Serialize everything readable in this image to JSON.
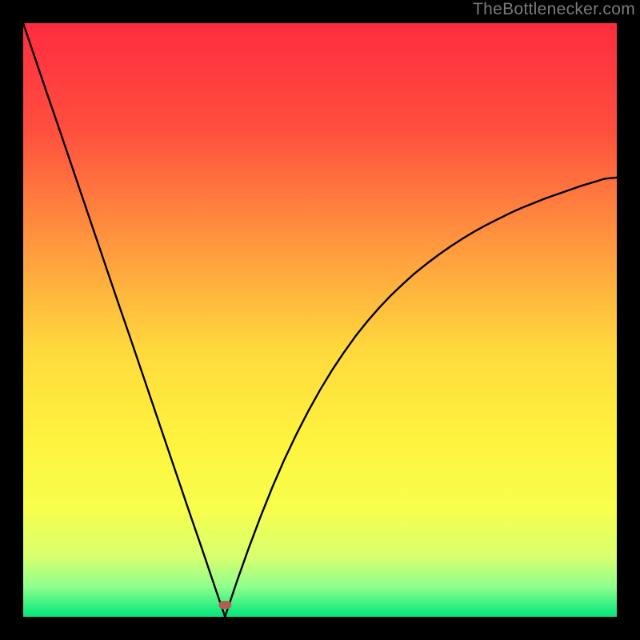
{
  "watermark": "TheBottlenecker.com",
  "chart_data": {
    "type": "line",
    "title": "",
    "xlabel": "",
    "ylabel": "",
    "xlim": [
      0,
      100
    ],
    "ylim": [
      0,
      100
    ],
    "minimum_x": 34,
    "minimum_y": 2,
    "marker": {
      "x": 34,
      "y": 2,
      "color": "#b45b54"
    },
    "x": [
      0,
      2,
      4,
      6,
      8,
      10,
      12,
      14,
      16,
      18,
      20,
      22,
      24,
      26,
      28,
      30,
      32,
      34,
      36,
      38,
      40,
      42,
      44,
      46,
      48,
      50,
      52,
      54,
      56,
      58,
      60,
      62,
      64,
      66,
      68,
      70,
      72,
      74,
      76,
      78,
      80,
      82,
      84,
      86,
      88,
      90,
      92,
      94,
      96,
      98,
      100
    ],
    "values": [
      100.0,
      94.1,
      88.2,
      82.4,
      76.5,
      70.6,
      64.7,
      58.8,
      52.9,
      47.1,
      41.2,
      35.3,
      29.4,
      23.5,
      17.6,
      11.8,
      5.88,
      0.0,
      5.97,
      11.6,
      16.9,
      21.9,
      26.5,
      30.7,
      34.6,
      38.2,
      41.5,
      44.5,
      47.3,
      49.8,
      52.1,
      54.2,
      56.1,
      57.9,
      59.5,
      61.0,
      62.4,
      63.7,
      64.9,
      66.0,
      67.0,
      68.0,
      68.9,
      69.7,
      70.5,
      71.2,
      71.9,
      72.6,
      73.2,
      73.8,
      74.0
    ],
    "gradient_stops": [
      {
        "offset": 0.0,
        "color": "#ff2c40"
      },
      {
        "offset": 0.18,
        "color": "#ff4f3e"
      },
      {
        "offset": 0.4,
        "color": "#ffa23e"
      },
      {
        "offset": 0.55,
        "color": "#ffd93d"
      },
      {
        "offset": 0.7,
        "color": "#fff33d"
      },
      {
        "offset": 0.82,
        "color": "#f7ff4d"
      },
      {
        "offset": 0.9,
        "color": "#d8ff70"
      },
      {
        "offset": 0.95,
        "color": "#8dff8d"
      },
      {
        "offset": 1.0,
        "color": "#00e57a"
      }
    ]
  }
}
